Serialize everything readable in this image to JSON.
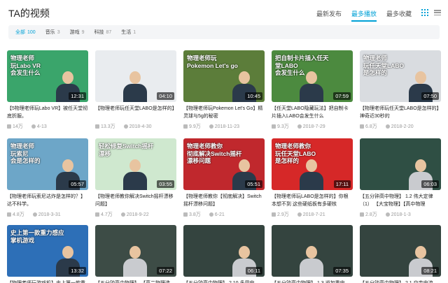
{
  "header": {
    "title": "TA的视频",
    "sort_tabs": [
      {
        "label": "最新发布",
        "active": false
      },
      {
        "label": "最多播放",
        "active": true
      },
      {
        "label": "最多收藏",
        "active": false
      }
    ],
    "view_icons": [
      "grid-view-icon",
      "list-view-icon"
    ]
  },
  "filters": [
    {
      "label": "全部",
      "count": "100",
      "active": true
    },
    {
      "label": "音乐",
      "count": "3",
      "active": false
    },
    {
      "label": "游戏",
      "count": "9",
      "active": false
    },
    {
      "label": "科技",
      "count": "87",
      "active": false
    },
    {
      "label": "生活",
      "count": "1",
      "active": false
    }
  ],
  "videos": [
    {
      "thumb_color": "#3aa56b",
      "overlay": "物理老师\n玩Labo VR\n会发生什么",
      "duration": "12:31",
      "title": "【5物理老师玩Labo VR】被任天堂彻底折服。",
      "plays": "14万",
      "date": "4-13"
    },
    {
      "thumb_color": "#e9ecef",
      "overlay": "",
      "duration": "04:10",
      "title": "【物理老师玩任天堂LABO是怎样的】",
      "plays": "13.3万",
      "date": "2018-4-30"
    },
    {
      "thumb_color": "#5c7d3a",
      "overlay": "物理老师玩 Pokemon Let's go",
      "duration": "10:45",
      "title": "【物理老师玩Pokemon Let's Go】精灵球与5g的秘密",
      "plays": "9.9万",
      "date": "2018-11-23"
    },
    {
      "thumb_color": "#4c8a3f",
      "overlay": "把自制卡片插入任天堂LABO\n会发生什么",
      "duration": "07:59",
      "title": "【任天堂LABO隐藏玩法】把自制卡片插入LABO会发生什么",
      "plays": "9.3万",
      "date": "2018-7-29"
    },
    {
      "thumb_color": "#d9dce0",
      "overlay": "物理老师\n玩任天堂LABO\n是怎样的",
      "duration": "07:50",
      "title": "【物理老师玩任天堂LABO是怎样的】神奇近30秒的",
      "plays": "6.8万",
      "date": "2018-2-20"
    },
    {
      "thumb_color": "#6da6c8",
      "overlay": "物理老师\n玩索尼\n会是怎样的",
      "duration": "05:57",
      "title": "【物理老师玩索尼达炸是怎样的？】达不科学。",
      "plays": "4.8万",
      "date": "2018-3-31"
    },
    {
      "thumb_color": "#cfe8cf",
      "overlay": "轻松修复Switch摇杆漂移",
      "duration": "03:55",
      "title": "【物理老师教你解决Switch摇杆漂移问题】",
      "plays": "4.7万",
      "date": "2018-9-22"
    },
    {
      "thumb_color": "#c0282d",
      "overlay": "物理老师教你\n彻底解决Switch摇杆漂移问题",
      "duration": "05:51",
      "title": "【物理老师教你【彻底解决】Switch摇杆漂移问题】",
      "plays": "3.8万",
      "date": "6-21"
    },
    {
      "thumb_color": "#d62828",
      "overlay": "物理老师教你\n玩任天堂LABO\n是怎样的",
      "duration": "17:11",
      "title": "【物理老师玩LABO是怎样的】你根本想不到 这些硬纸板有多硬核",
      "plays": "2.9万",
      "date": "2018-7-21"
    },
    {
      "thumb_color": "#2f4f44",
      "overlay": "",
      "duration": "06:03",
      "title": "【五分钟高中物理】 1.2 伟大定律（1） 【大宝物理】【高中物理",
      "plays": "2.8万",
      "date": "2018-1-3"
    },
    {
      "thumb_color": "#2d6fb7",
      "overlay": "史上第一款重力感应掌机游戏",
      "duration": "13:32",
      "title": "【物理老师玩游戏机】史上第一款重",
      "plays": "",
      "date": ""
    },
    {
      "thumb_color": "#3d4c46",
      "overlay": "",
      "duration": "07:22",
      "title": "【五分钟高中物理】 【高二物理选",
      "plays": "",
      "date": ""
    },
    {
      "thumb_color": "#34443f",
      "overlay": "",
      "duration": "06:11",
      "title": "【五分钟高中物理】 2.10 多用电",
      "plays": "",
      "date": ""
    },
    {
      "thumb_color": "#34443f",
      "overlay": "",
      "duration": "07:35",
      "title": "【五分钟高中物理】 1.3 说加重电",
      "plays": "",
      "date": ""
    },
    {
      "thumb_color": "#34443f",
      "overlay": "",
      "duration": "08:21",
      "title": "【五分钟高中物理】 2.1 交变电流",
      "plays": "",
      "date": ""
    }
  ]
}
